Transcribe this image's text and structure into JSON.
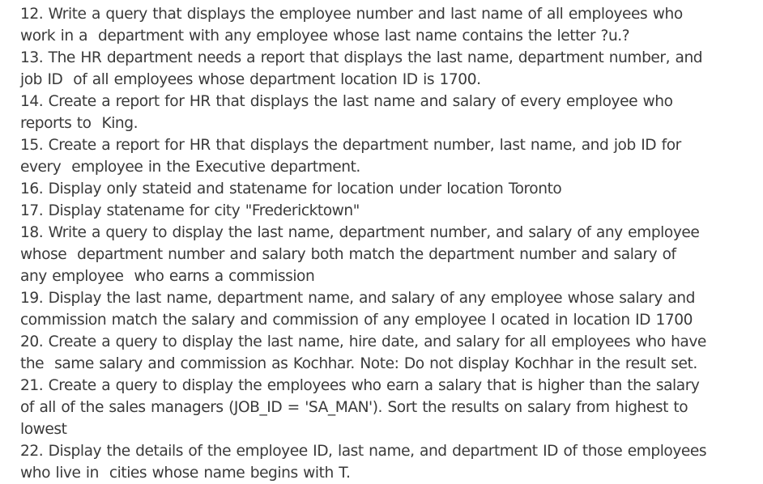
{
  "lines": [
    "12. Write a query that displays the employee number and last name of all employees who",
    "work in a  department with any employee whose last name contains the letter ?u.?",
    "13. The HR department needs a report that displays the last name, department number, and",
    "job ID  of all employees whose department location ID is 1700.",
    "14. Create a report for HR that displays the last name and salary of every employee who",
    "reports to  King.",
    "15. Create a report for HR that displays the department number, last name, and job ID for",
    "every  employee in the Executive department.",
    "16. Display only stateid and statename for location under location Toronto",
    "17. Display statename for city \"Fredericktown\"",
    "18. Write a query to display the last name, department number, and salary of any employee",
    "whose  department number and salary both match the department number and salary of",
    "any employee  who earns a commission",
    "19. Display the last name, department name, and salary of any employee whose salary and",
    "commission match the salary and commission of any employee l ocated in location ID 1700",
    "20. Create a query to display the last name, hire date, and salary for all employees who have",
    "the  same salary and commission as Kochhar. Note: Do not display Kochhar in the result set.",
    "21. Create a query to display the employees who earn a salary that is higher than the salary",
    "of all of the sales managers (JOB_ID = 'SA_MAN'). Sort the results on salary from highest to",
    "lowest",
    "22. Display the details of the employee ID, last name, and department ID of those employees",
    "who live in  cities whose name begins with T."
  ]
}
